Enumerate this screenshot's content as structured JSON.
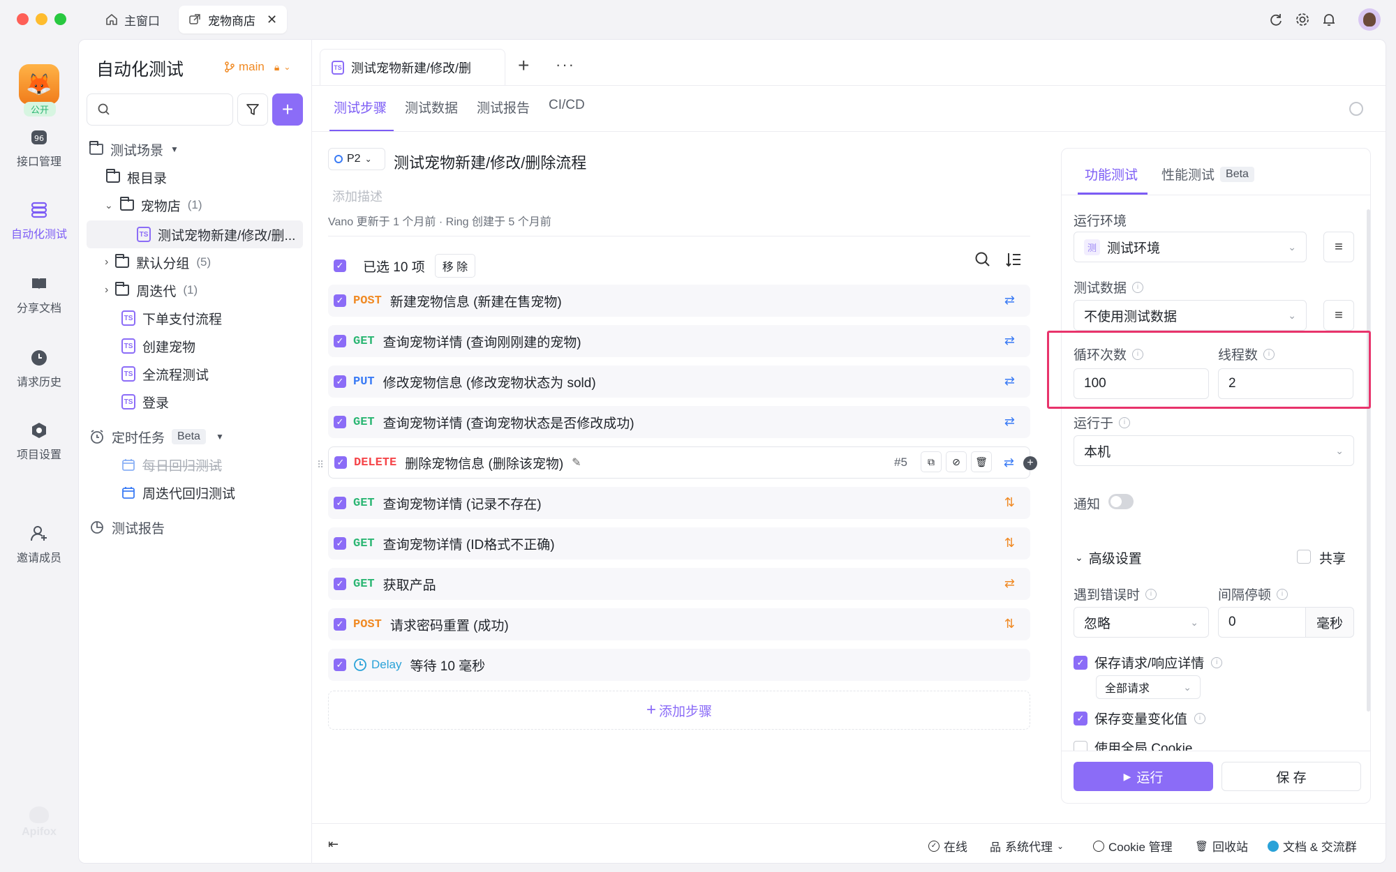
{
  "titlebar": {
    "home_tab": "主窗口",
    "active_tab": "宠物商店"
  },
  "leftnav": {
    "avatar_badge": "公开",
    "items": [
      {
        "label": "接口管理"
      },
      {
        "label": "自动化测试"
      },
      {
        "label": "分享文档"
      },
      {
        "label": "请求历史"
      },
      {
        "label": "项目设置"
      },
      {
        "label": "邀请成员"
      }
    ],
    "logo": "Apifox"
  },
  "sidebar": {
    "title": "自动化测试",
    "branch": "main",
    "tree": {
      "scenes_label": "测试场景",
      "root": "根目录",
      "petstore": "宠物店",
      "petstore_count": "(1)",
      "petstore_item": "测试宠物新建/修改/删...",
      "default_group": "默认分组",
      "default_count": "(5)",
      "sprint": "周迭代",
      "sprint_count": "(1)",
      "items": [
        "下单支付流程",
        "创建宠物",
        "全流程测试",
        "登录"
      ],
      "scheduled_label": "定时任务",
      "scheduled_badge": "Beta",
      "scheduled_items": [
        "每日回归测试",
        "周迭代回归测试"
      ],
      "reports_label": "测试报告"
    }
  },
  "editor": {
    "doc_tab": "测试宠物新建/修改/删",
    "subtabs": [
      "测试步骤",
      "测试数据",
      "测试报告",
      "CI/CD"
    ],
    "priority": "P2",
    "title": "测试宠物新建/修改/删除流程",
    "desc_placeholder": "添加描述",
    "meta": "Vano 更新于 1 个月前 · Ring 创建于 5 个月前",
    "selected_text": "已选 10 项",
    "remove_label": "移 除",
    "steps": [
      {
        "method": "POST",
        "name": "新建宠物信息 (新建在售宠物)"
      },
      {
        "method": "GET",
        "name": "查询宠物详情 (查询刚刚建的宠物)"
      },
      {
        "method": "PUT",
        "name": "修改宠物信息 (修改宠物状态为 sold)"
      },
      {
        "method": "GET",
        "name": "查询宠物详情 (查询宠物状态是否修改成功)"
      },
      {
        "method": "DELETE",
        "name": "删除宠物信息 (删除该宠物)",
        "index": "#5"
      },
      {
        "method": "GET",
        "name": "查询宠物详情 (记录不存在)"
      },
      {
        "method": "GET",
        "name": "查询宠物详情 (ID格式不正确)"
      },
      {
        "method": "GET",
        "name": "获取产品"
      },
      {
        "method": "POST",
        "name": "请求密码重置 (成功)"
      },
      {
        "method": "Delay",
        "name": "等待 10 毫秒"
      }
    ],
    "add_step": "添加步骤"
  },
  "runpanel": {
    "tab_functional": "功能测试",
    "tab_performance": "性能测试",
    "tab_performance_badge": "Beta",
    "env_label": "运行环境",
    "env_badge": "测",
    "env_value": "测试环境",
    "data_label": "测试数据",
    "data_value": "不使用测试数据",
    "loops_label": "循环次数",
    "loops_value": "100",
    "threads_label": "线程数",
    "threads_value": "2",
    "run_on_label": "运行于",
    "run_on_value": "本机",
    "notify_label": "通知",
    "advanced_label": "高级设置",
    "share_label": "共享",
    "on_error_label": "遇到错误时",
    "on_error_value": "忽略",
    "interval_label": "间隔停顿",
    "interval_value": "0",
    "interval_unit": "毫秒",
    "save_req_label": "保存请求/响应详情",
    "save_req_select": "全部请求",
    "save_var_label": "保存变量变化值",
    "global_cookie_label": "使用全局 Cookie",
    "run_button": "运行",
    "save_button": "保 存"
  },
  "footer": {
    "online": "在线",
    "proxy": "系统代理",
    "cookie": "Cookie 管理",
    "trash": "回收站",
    "docs": "文档 & 交流群"
  },
  "colors": {
    "accent": "#7c5cf5",
    "highlight_box": "#e8336b"
  }
}
